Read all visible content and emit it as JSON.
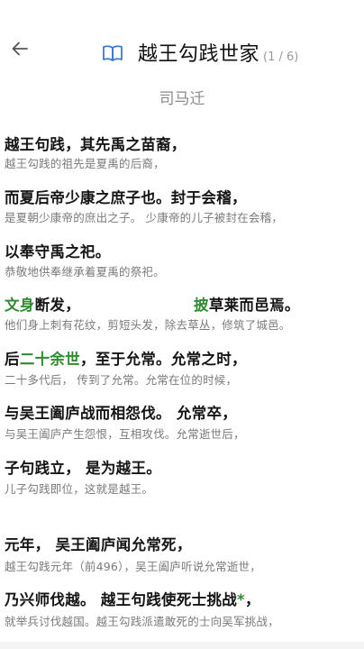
{
  "header": {
    "back_icon": "arrow-left-icon",
    "book_icon": "open-book-icon",
    "title": "越王勾践世家",
    "page_indicator": "(1 / 6)",
    "accent_color": "#3a7bd5"
  },
  "author": "司马迁",
  "highlight_color": "#2e8b2e",
  "passages": [
    {
      "orig": "越王句践，其先禹之苗裔，",
      "trans": "越王勾践的祖先是夏禹的后裔，"
    },
    {
      "orig": "而夏后帝少康之庶子也。封于会稽，",
      "trans": "是夏朝少康帝的庶出之子。   少康帝的儿子被封在会稽，"
    },
    {
      "orig": "以奉守禹之祀。",
      "trans": "恭敬地供奉继承着夏禹的祭祀。"
    },
    {
      "orig_parts": [
        "文身",
        "断发，",
        "披",
        "草莱而邑焉。"
      ],
      "trans": "他们身上刺有花纹，剪短头发，除去草丛，修筑了城邑。"
    },
    {
      "orig_parts": [
        "后",
        "二十余世",
        "，至于允常。允常之时，"
      ],
      "trans": "二十多代后，   传到了允常。允常在位的时候，"
    },
    {
      "orig": "与吴王阖庐战而相怨伐。   允常卒，",
      "trans": "与吴王阖庐产生怨恨，互相攻伐。允常逝世后，"
    },
    {
      "orig": "子句践立，  是为越王。",
      "trans": "儿子勾践即位，这就是越王。"
    },
    {
      "orig": "元年，         吴王阖庐闻允常死，",
      "trans": "越王勾践元年（前496），吴王阖庐听说允常逝世，"
    },
    {
      "orig": "乃兴师伐越。  越王句践使死士挑战",
      "orig_star": "*",
      "orig_tail": "，",
      "trans": "就举兵讨伐越国。越王勾践派遣敢死的士向吴军挑战，"
    }
  ]
}
